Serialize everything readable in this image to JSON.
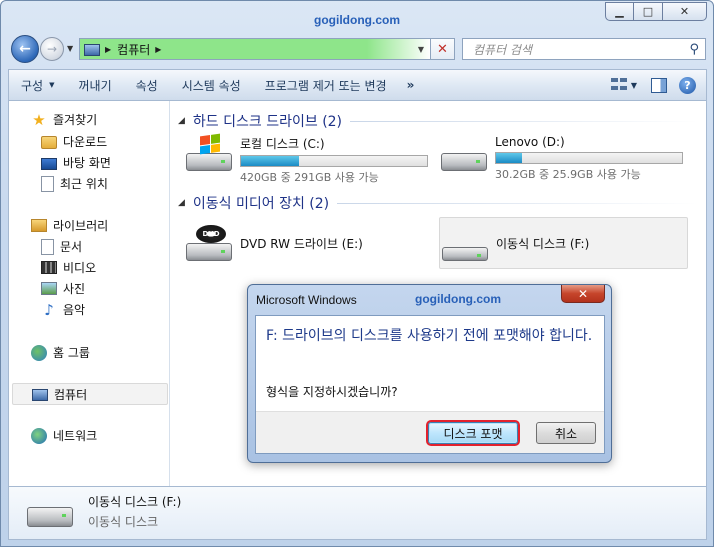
{
  "watermark": "gogildong.com",
  "window": {
    "min_glyph": "▁",
    "max_glyph": "□",
    "close_glyph": "✕"
  },
  "address": {
    "crumb": "컴퓨터",
    "clear_glyph": "✕"
  },
  "search": {
    "placeholder": "컴퓨터 검색"
  },
  "toolbar": {
    "organize": "구성",
    "eject": "꺼내기",
    "properties": "속성",
    "system_properties": "시스템 속성",
    "uninstall": "프로그램 제거 또는 변경",
    "more": "»",
    "help": "?"
  },
  "sidebar": {
    "favorites": "즐겨찾기",
    "downloads": "다운로드",
    "desktop": "바탕 화면",
    "recent": "최근 위치",
    "libraries": "라이브러리",
    "documents": "문서",
    "videos": "비디오",
    "pictures": "사진",
    "music": "음악",
    "homegroup": "홈 그룹",
    "computer": "컴퓨터",
    "network": "네트워크"
  },
  "groups": {
    "hdd_header": "하드 디스크 드라이브 (2)",
    "removable_header": "이동식 미디어 장치 (2)"
  },
  "drives": [
    {
      "name": "로컬 디스크 (C:)",
      "free_text": "420GB 중 291GB 사용 가능",
      "used_fraction": 0.31
    },
    {
      "name": "Lenovo (D:)",
      "free_text": "30.2GB 중 25.9GB 사용 가능",
      "used_fraction": 0.14
    },
    {
      "name": "DVD RW 드라이브 (E:)",
      "badge": "DVD"
    },
    {
      "name": "이동식 디스크 (F:)"
    }
  ],
  "details": {
    "name": "이동식 디스크 (F:)",
    "type": "이동식 디스크"
  },
  "dialog": {
    "title": "Microsoft Windows",
    "watermark": "gogildong.com",
    "message": "F: 드라이브의 디스크를 사용하기 전에 포맷해야 합니다.",
    "question": "형식을 지정하시겠습니까?",
    "format_button": "디스크 포맷",
    "cancel_button": "취소",
    "close_glyph": "✕"
  }
}
